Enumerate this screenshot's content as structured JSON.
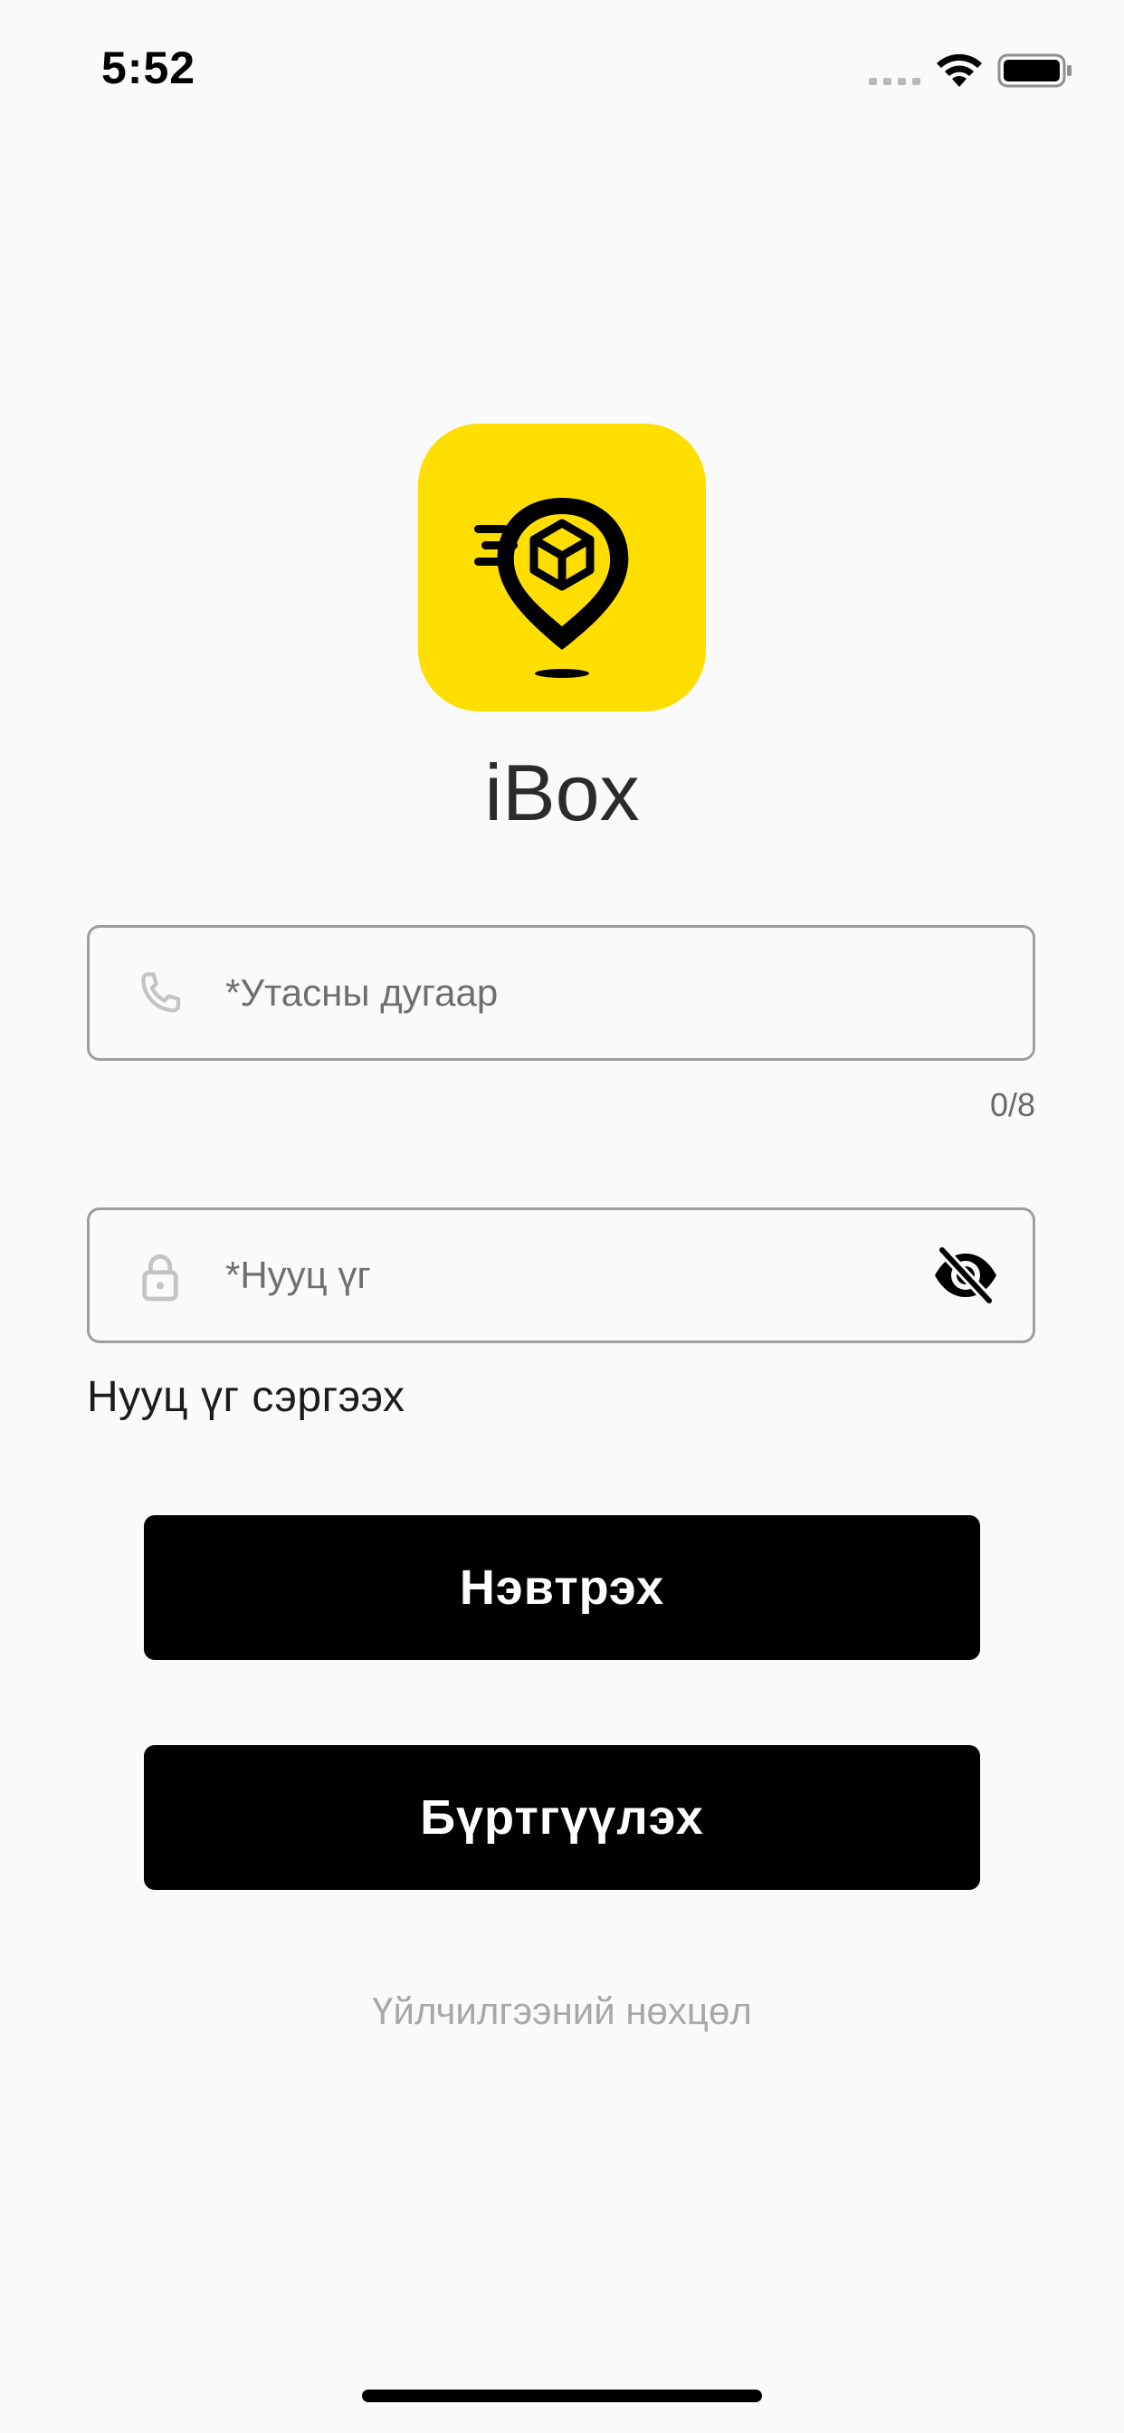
{
  "status_bar": {
    "time": "5:52",
    "icons": [
      "signal-icon",
      "wifi-icon",
      "battery-icon"
    ]
  },
  "app": {
    "name": "iBox",
    "logo_icon": "box-location-pin-logo",
    "logo_color": "#FFDE00"
  },
  "form": {
    "phone": {
      "placeholder": "*Утасны дугаар",
      "value": "",
      "counter": "0/8",
      "icon": "phone-icon"
    },
    "password": {
      "placeholder": "*Нууц үг",
      "value": "",
      "icon": "lock-icon",
      "toggle_icon": "eye-off-icon"
    },
    "forgot_password_label": "Нууц үг сэргээх"
  },
  "actions": {
    "login_label": "Нэвтрэх",
    "register_label": "Бүртгүүлэх"
  },
  "footer": {
    "terms_label": "Үйлчилгээний нөхцөл"
  },
  "colors": {
    "background": "#FAFAFA",
    "button": "#000000",
    "button_text": "#FFFFFF",
    "field_border": "#9E9E9E",
    "muted_text": "#A8A8A8"
  }
}
